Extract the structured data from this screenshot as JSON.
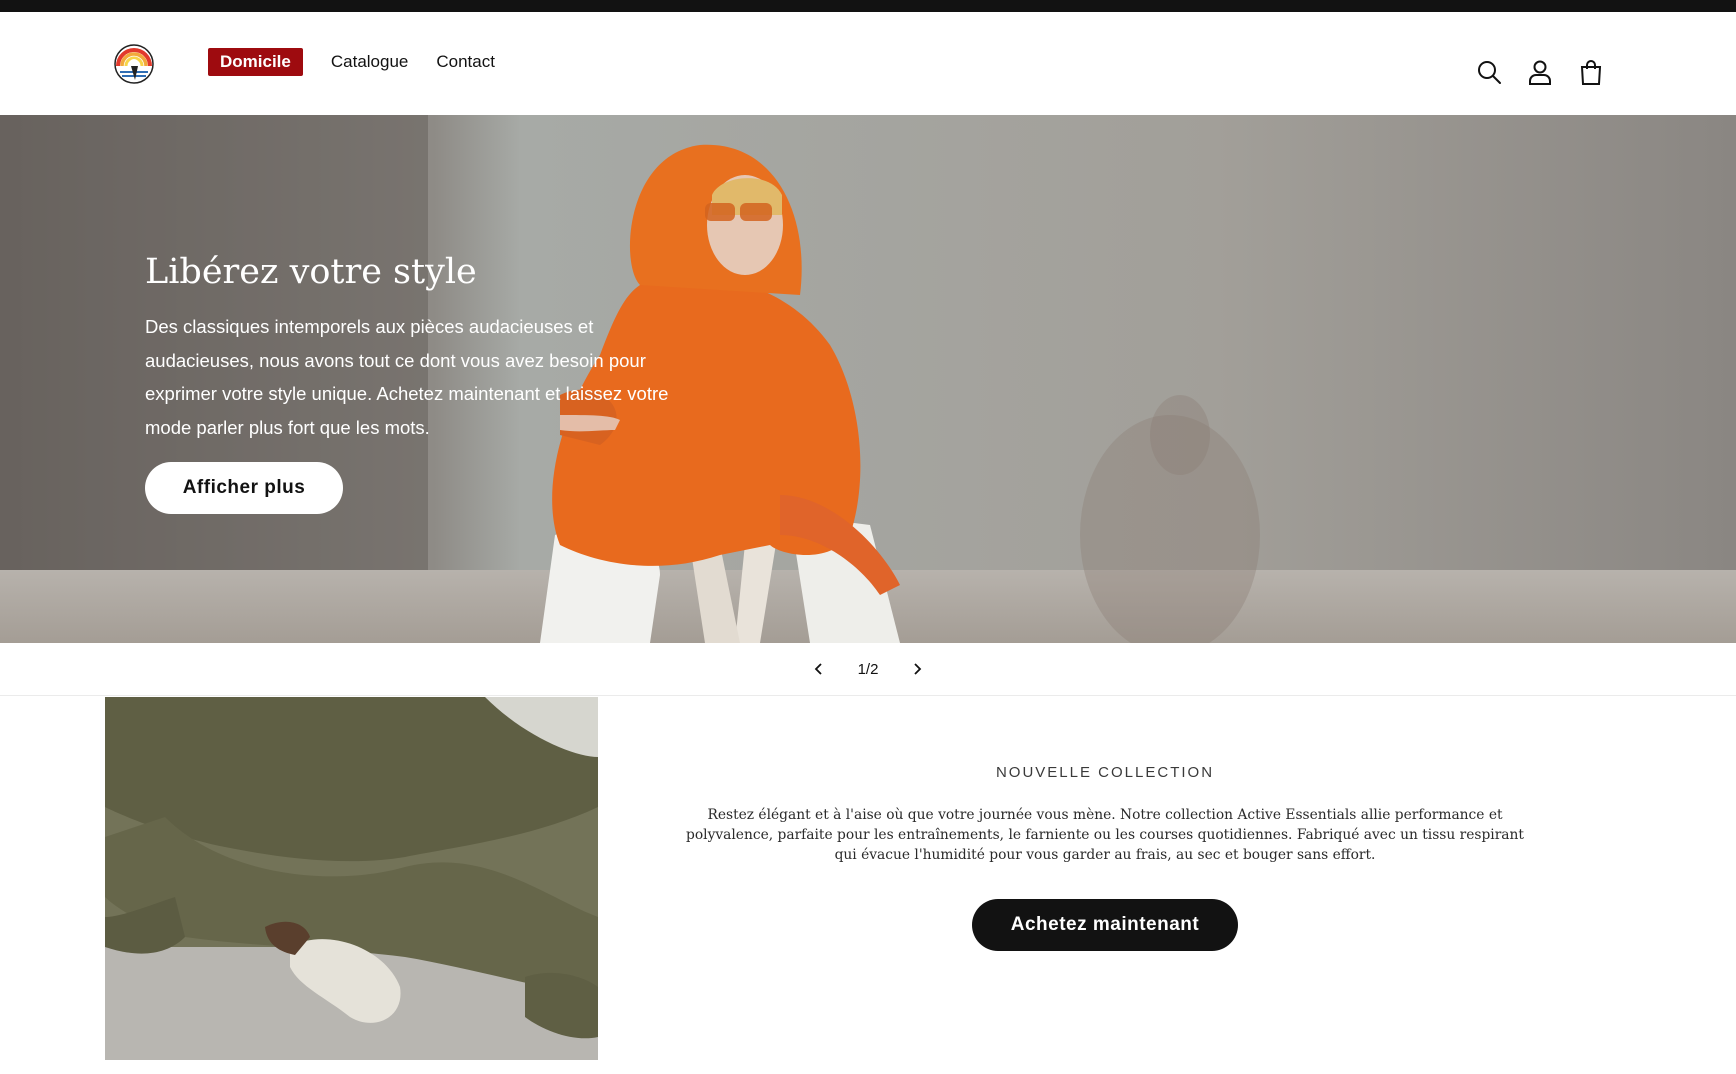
{
  "header": {
    "logo_alt": "rainbow-logo",
    "nav": [
      {
        "label": "Domicile",
        "active": true
      },
      {
        "label": "Catalogue",
        "active": false
      },
      {
        "label": "Contact",
        "active": false
      }
    ],
    "icons": [
      "search-icon",
      "account-icon",
      "cart-icon"
    ]
  },
  "hero": {
    "title": "Libérez votre style",
    "text": "Des classiques intemporels aux pièces audacieuses et audacieuses, nous avons tout ce dont vous avez besoin pour exprimer votre style unique. Achetez maintenant et laissez votre mode parler plus fort que les mots.",
    "button": "Afficher plus"
  },
  "slider": {
    "counter": "1/2"
  },
  "collection": {
    "heading": "NOUVELLE COLLECTION",
    "text": "Restez élégant et à l'aise où que votre journée vous mène. Notre collection Active Essentials allie performance et polyvalence, parfaite pour les entraînements, le farniente ou les courses quotidiennes. Fabriqué avec un tissu respirant qui évacue l'humidité pour vous garder au frais, au sec et bouger sans effort.",
    "button": "Achetez maintenant"
  },
  "colors": {
    "accent": "#9e0b0f",
    "text": "#121212",
    "hoodie": "#e86a1e"
  }
}
